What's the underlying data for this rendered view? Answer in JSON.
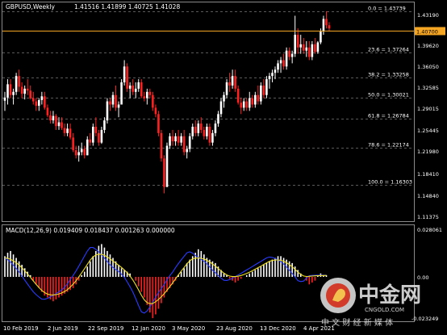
{
  "header": {
    "symbol_info": "GBPUSD,Weekly",
    "ohlc": "1.41516 1.41899 1.40725 1.41028"
  },
  "price_axis": {
    "labels": [
      "1.43190",
      "1.39620",
      "1.36050",
      "1.32585",
      "1.29015",
      "1.25445",
      "1.21980",
      "1.18410",
      "1.14840",
      "1.11375"
    ],
    "current_price": "1.40700"
  },
  "fib_levels": [
    {
      "label": "0.0 = 1.43739",
      "value": 1.43739
    },
    {
      "label": "23.6 = 1.37264",
      "value": 1.37264
    },
    {
      "label": "38.2 = 1.33258",
      "value": 1.33258
    },
    {
      "label": "50.0 = 1.30021",
      "value": 1.30021
    },
    {
      "label": "61.8 = 1.26784",
      "value": 1.26784
    },
    {
      "label": "78.6 = 1.22174",
      "value": 1.22174
    },
    {
      "label": "100.0 = 1.16303",
      "value": 1.16303
    }
  ],
  "macd": {
    "label": "MACD(12,26,9) 0.019409 0.018437 0.001263 0.000000",
    "axis_labels": [
      "0.028061",
      "0.00",
      "-0.023249"
    ]
  },
  "x_axis": {
    "labels": [
      "10 Feb 2019",
      "2 Jun 2019",
      "22 Sep 2019",
      "12 Jan 2020",
      "3 May 2020",
      "23 Aug 2020",
      "13 Dec 2020",
      "4 Apr 2021"
    ]
  },
  "watermark": {
    "brand": "中金网",
    "url": "CNGOLD.COM",
    "slogan": "中 文 财 经 新 媒 体"
  },
  "colors": {
    "bull": "#ffffff",
    "bear": "#ff2020",
    "price_line": "#f5a623",
    "macd_line": "#2a3bff",
    "signal_line": "#f0e020",
    "grid": "#5a5a5a"
  },
  "chart_data": {
    "type": "candlestick",
    "ohlc": [
      [
        1.296,
        1.31,
        1.28,
        1.301
      ],
      [
        1.301,
        1.33,
        1.29,
        1.322
      ],
      [
        1.322,
        1.33,
        1.3,
        1.305
      ],
      [
        1.305,
        1.315,
        1.29,
        1.31
      ],
      [
        1.31,
        1.34,
        1.305,
        1.335
      ],
      [
        1.335,
        1.345,
        1.31,
        1.318
      ],
      [
        1.318,
        1.325,
        1.3,
        1.307
      ],
      [
        1.307,
        1.32,
        1.298,
        1.315
      ],
      [
        1.315,
        1.33,
        1.305,
        1.312
      ],
      [
        1.312,
        1.32,
        1.298,
        1.3
      ],
      [
        1.3,
        1.31,
        1.29,
        1.295
      ],
      [
        1.295,
        1.3,
        1.28,
        1.288
      ],
      [
        1.288,
        1.3,
        1.28,
        1.297
      ],
      [
        1.297,
        1.31,
        1.29,
        1.303
      ],
      [
        1.303,
        1.31,
        1.282,
        1.285
      ],
      [
        1.285,
        1.29,
        1.27,
        1.273
      ],
      [
        1.273,
        1.28,
        1.26,
        1.265
      ],
      [
        1.265,
        1.28,
        1.26,
        1.272
      ],
      [
        1.272,
        1.275,
        1.25,
        1.256
      ],
      [
        1.256,
        1.27,
        1.25,
        1.262
      ],
      [
        1.262,
        1.27,
        1.25,
        1.253
      ],
      [
        1.253,
        1.26,
        1.24,
        1.245
      ],
      [
        1.245,
        1.26,
        1.24,
        1.252
      ],
      [
        1.252,
        1.26,
        1.235,
        1.238
      ],
      [
        1.238,
        1.245,
        1.215,
        1.218
      ],
      [
        1.218,
        1.225,
        1.205,
        1.21
      ],
      [
        1.21,
        1.225,
        1.2,
        1.215
      ],
      [
        1.215,
        1.23,
        1.21,
        1.22
      ],
      [
        1.22,
        1.225,
        1.205,
        1.21
      ],
      [
        1.21,
        1.24,
        1.21,
        1.235
      ],
      [
        1.235,
        1.245,
        1.225,
        1.23
      ],
      [
        1.23,
        1.26,
        1.225,
        1.255
      ],
      [
        1.255,
        1.27,
        1.24,
        1.245
      ],
      [
        1.245,
        1.25,
        1.225,
        1.23
      ],
      [
        1.23,
        1.255,
        1.228,
        1.25
      ],
      [
        1.25,
        1.27,
        1.245,
        1.265
      ],
      [
        1.265,
        1.3,
        1.26,
        1.295
      ],
      [
        1.295,
        1.3,
        1.28,
        1.29
      ],
      [
        1.29,
        1.31,
        1.285,
        1.305
      ],
      [
        1.305,
        1.32,
        1.28,
        1.285
      ],
      [
        1.285,
        1.295,
        1.27,
        1.29
      ],
      [
        1.29,
        1.33,
        1.29,
        1.325
      ],
      [
        1.325,
        1.36,
        1.32,
        1.35
      ],
      [
        1.35,
        1.355,
        1.31,
        1.315
      ],
      [
        1.315,
        1.325,
        1.3,
        1.32
      ],
      [
        1.32,
        1.33,
        1.305,
        1.31
      ],
      [
        1.31,
        1.325,
        1.3,
        1.315
      ],
      [
        1.315,
        1.33,
        1.31,
        1.325
      ],
      [
        1.325,
        1.33,
        1.3,
        1.303
      ],
      [
        1.303,
        1.31,
        1.295,
        1.3
      ],
      [
        1.3,
        1.315,
        1.29,
        1.31
      ],
      [
        1.31,
        1.315,
        1.3,
        1.305
      ],
      [
        1.305,
        1.31,
        1.28,
        1.285
      ],
      [
        1.285,
        1.29,
        1.27,
        1.275
      ],
      [
        1.275,
        1.28,
        1.24,
        1.245
      ],
      [
        1.245,
        1.25,
        1.2,
        1.205
      ],
      [
        1.205,
        1.21,
        1.15,
        1.16
      ],
      [
        1.16,
        1.23,
        1.16,
        1.225
      ],
      [
        1.225,
        1.245,
        1.22,
        1.24
      ],
      [
        1.24,
        1.25,
        1.225,
        1.232
      ],
      [
        1.232,
        1.245,
        1.225,
        1.24
      ],
      [
        1.24,
        1.25,
        1.225,
        1.23
      ],
      [
        1.23,
        1.245,
        1.225,
        1.24
      ],
      [
        1.24,
        1.25,
        1.21,
        1.215
      ],
      [
        1.215,
        1.225,
        1.205,
        1.22
      ],
      [
        1.22,
        1.245,
        1.215,
        1.24
      ],
      [
        1.24,
        1.26,
        1.235,
        1.255
      ],
      [
        1.255,
        1.265,
        1.24,
        1.245
      ],
      [
        1.245,
        1.265,
        1.24,
        1.26
      ],
      [
        1.26,
        1.27,
        1.245,
        1.25
      ],
      [
        1.25,
        1.255,
        1.235,
        1.24
      ],
      [
        1.24,
        1.26,
        1.235,
        1.255
      ],
      [
        1.255,
        1.26,
        1.225,
        1.23
      ],
      [
        1.23,
        1.25,
        1.225,
        1.245
      ],
      [
        1.245,
        1.265,
        1.24,
        1.26
      ],
      [
        1.26,
        1.28,
        1.255,
        1.275
      ],
      [
        1.275,
        1.3,
        1.27,
        1.295
      ],
      [
        1.295,
        1.31,
        1.285,
        1.305
      ],
      [
        1.305,
        1.33,
        1.3,
        1.325
      ],
      [
        1.325,
        1.34,
        1.31,
        1.32
      ],
      [
        1.32,
        1.345,
        1.315,
        1.335
      ],
      [
        1.335,
        1.345,
        1.31,
        1.315
      ],
      [
        1.315,
        1.32,
        1.29,
        1.293
      ],
      [
        1.293,
        1.3,
        1.275,
        1.285
      ],
      [
        1.285,
        1.3,
        1.28,
        1.295
      ],
      [
        1.295,
        1.3,
        1.28,
        1.285
      ],
      [
        1.285,
        1.31,
        1.28,
        1.3
      ],
      [
        1.3,
        1.305,
        1.285,
        1.29
      ],
      [
        1.29,
        1.31,
        1.285,
        1.305
      ],
      [
        1.305,
        1.32,
        1.29,
        1.295
      ],
      [
        1.295,
        1.325,
        1.29,
        1.32
      ],
      [
        1.32,
        1.33,
        1.3,
        1.305
      ],
      [
        1.305,
        1.335,
        1.3,
        1.33
      ],
      [
        1.33,
        1.34,
        1.315,
        1.335
      ],
      [
        1.335,
        1.345,
        1.325,
        1.34
      ],
      [
        1.34,
        1.35,
        1.33,
        1.345
      ],
      [
        1.345,
        1.36,
        1.34,
        1.355
      ],
      [
        1.355,
        1.365,
        1.34,
        1.36
      ],
      [
        1.36,
        1.37,
        1.345,
        1.35
      ],
      [
        1.35,
        1.38,
        1.345,
        1.375
      ],
      [
        1.375,
        1.38,
        1.36,
        1.365
      ],
      [
        1.365,
        1.375,
        1.355,
        1.37
      ],
      [
        1.37,
        1.43,
        1.365,
        1.4
      ],
      [
        1.4,
        1.41,
        1.37,
        1.38
      ],
      [
        1.38,
        1.4,
        1.37,
        1.385
      ],
      [
        1.385,
        1.395,
        1.37,
        1.375
      ],
      [
        1.375,
        1.39,
        1.365,
        1.38
      ],
      [
        1.38,
        1.39,
        1.36,
        1.365
      ],
      [
        1.365,
        1.39,
        1.36,
        1.385
      ],
      [
        1.385,
        1.395,
        1.37,
        1.373
      ],
      [
        1.373,
        1.39,
        1.37,
        1.388
      ],
      [
        1.388,
        1.41,
        1.385,
        1.405
      ],
      [
        1.405,
        1.43,
        1.4,
        1.425
      ],
      [
        1.425,
        1.437,
        1.41,
        1.415
      ],
      [
        1.415,
        1.42,
        1.405,
        1.41
      ]
    ],
    "macd_hist": [
      0.012,
      0.014,
      0.015,
      0.013,
      0.011,
      0.009,
      0.007,
      0.005,
      0.003,
      0.001,
      -0.002,
      -0.004,
      -0.006,
      -0.008,
      -0.01,
      -0.011,
      -0.012,
      -0.013,
      -0.012,
      -0.011,
      -0.01,
      -0.009,
      -0.008,
      -0.007,
      -0.006,
      -0.004,
      -0.002,
      0.001,
      0.003,
      0.006,
      0.009,
      0.012,
      0.015,
      0.018,
      0.019,
      0.017,
      0.015,
      0.013,
      0.011,
      0.009,
      0.007,
      0.005,
      0.004,
      0.003,
      0.002,
      0.0,
      -0.002,
      -0.005,
      -0.008,
      -0.011,
      -0.015,
      -0.019,
      -0.022,
      -0.02,
      -0.017,
      -0.014,
      -0.011,
      -0.008,
      -0.006,
      -0.004,
      -0.002,
      0.001,
      0.003,
      0.005,
      0.008,
      0.01,
      0.012,
      0.014,
      0.016,
      0.015,
      0.013,
      0.011,
      0.01,
      0.009,
      0.008,
      0.006,
      0.004,
      0.002,
      0.001,
      -0.001,
      -0.002,
      -0.003,
      -0.002,
      -0.001,
      0.0,
      0.001,
      0.002,
      0.003,
      0.004,
      0.005,
      0.006,
      0.007,
      0.008,
      0.009,
      0.01,
      0.011,
      0.012,
      0.012,
      0.011,
      0.01,
      0.009,
      0.008,
      0.006,
      0.004,
      0.002,
      0.0,
      -0.002,
      -0.004,
      -0.003,
      -0.002,
      0.001,
      0.002,
      0.001,
      0.001
    ]
  }
}
